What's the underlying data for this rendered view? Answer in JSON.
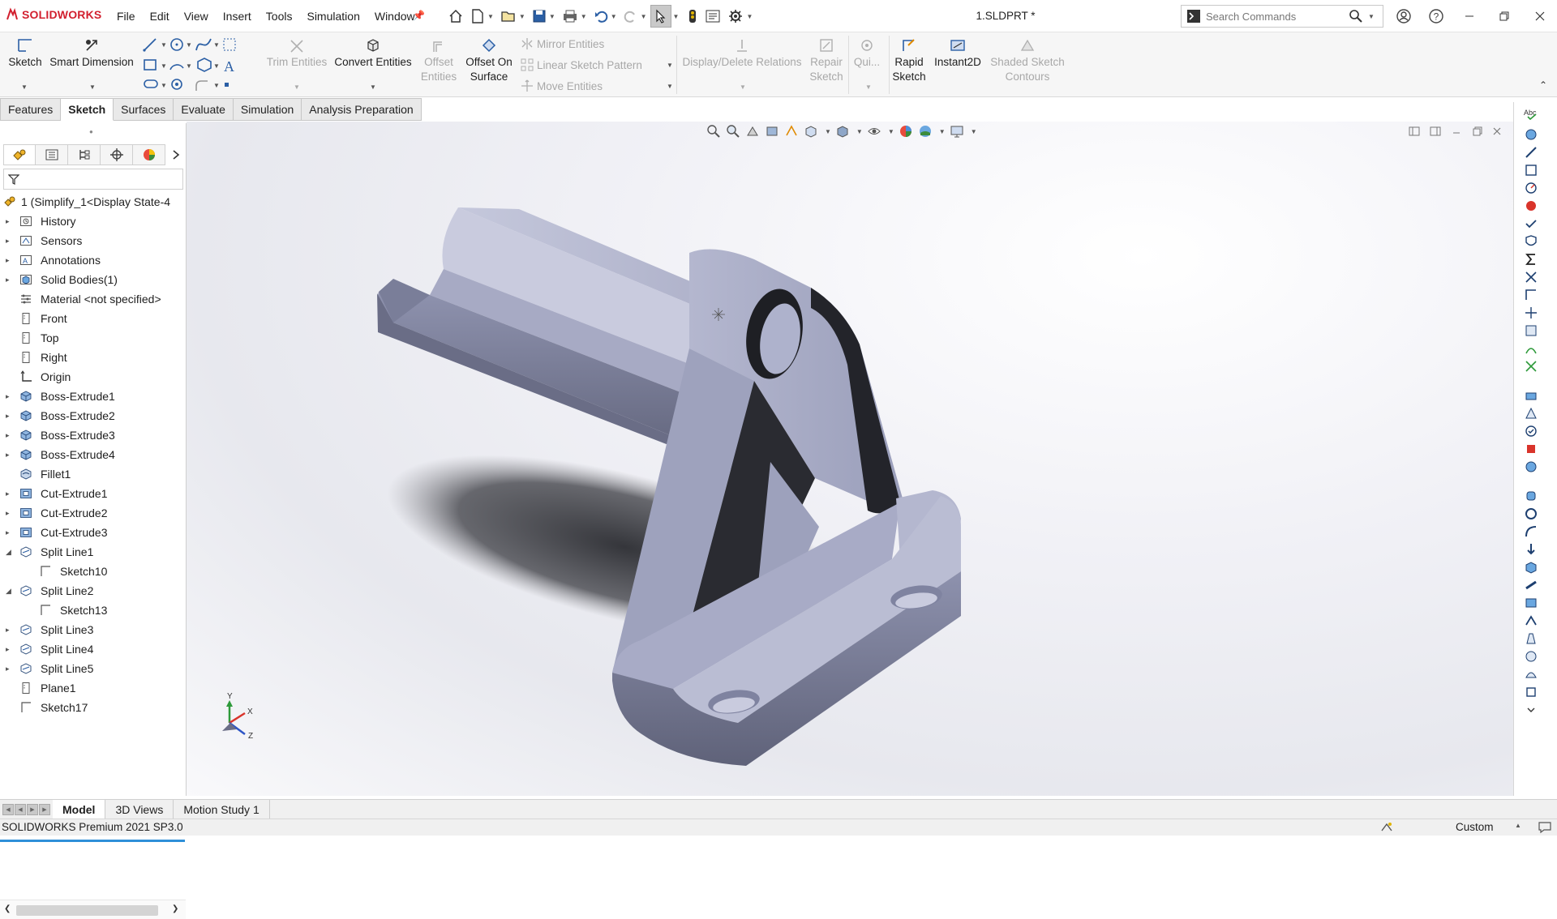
{
  "app": {
    "brand": "SOLIDWORKS",
    "brand_color": "#d2202f",
    "accent": "#2e8fd8",
    "model_color": "#a9adc8"
  },
  "menu": [
    "File",
    "Edit",
    "View",
    "Insert",
    "Tools",
    "Simulation",
    "Window"
  ],
  "window": {
    "title": "1.SLDPRT *"
  },
  "search": {
    "placeholder": "Search Commands"
  },
  "ribbon": {
    "sketch": "Sketch",
    "smart_dimension": "Smart Dimension",
    "trim_entities": "Trim Entities",
    "convert_entities": "Convert Entities",
    "offset_entities": [
      "Offset",
      "Entities"
    ],
    "offset_on_surface": [
      "Offset On",
      "Surface"
    ],
    "mirror_entities": "Mirror Entities",
    "linear_sketch_pattern": "Linear Sketch Pattern",
    "move_entities": "Move Entities",
    "display_delete_relations": "Display/Delete Relations",
    "repair_sketch": [
      "Repair",
      "Sketch"
    ],
    "quick_snaps": "Qui...",
    "rapid_sketch": [
      "Rapid",
      "Sketch"
    ],
    "instant2d": "Instant2D",
    "shaded_sketch_contours": [
      "Shaded Sketch",
      "Contours"
    ]
  },
  "command_tabs": [
    {
      "label": "Features",
      "active": false
    },
    {
      "label": "Sketch",
      "active": true
    },
    {
      "label": "Surfaces",
      "active": false
    },
    {
      "label": "Evaluate",
      "active": false
    },
    {
      "label": "Simulation",
      "active": false
    },
    {
      "label": "Analysis Preparation",
      "active": false
    }
  ],
  "tree": [
    {
      "label": "1  (Simplify_1<Display State-4",
      "icon": "part-icon",
      "expander": "none",
      "indent": 0
    },
    {
      "label": "History",
      "icon": "history-icon",
      "expander": "collapsed",
      "indent": 1
    },
    {
      "label": "Sensors",
      "icon": "sensors-icon",
      "expander": "collapsed",
      "indent": 1
    },
    {
      "label": "Annotations",
      "icon": "annotations-icon",
      "expander": "collapsed",
      "indent": 1
    },
    {
      "label": "Solid Bodies(1)",
      "icon": "solid-bodies-icon",
      "expander": "collapsed",
      "indent": 1
    },
    {
      "label": "Material <not specified>",
      "icon": "material-icon",
      "expander": "none",
      "indent": 1
    },
    {
      "label": "Front",
      "icon": "plane-icon",
      "expander": "none",
      "indent": 1
    },
    {
      "label": "Top",
      "icon": "plane-icon",
      "expander": "none",
      "indent": 1
    },
    {
      "label": "Right",
      "icon": "plane-icon",
      "expander": "none",
      "indent": 1
    },
    {
      "label": "Origin",
      "icon": "origin-icon",
      "expander": "none",
      "indent": 1
    },
    {
      "label": "Boss-Extrude1",
      "icon": "extrude-icon",
      "expander": "collapsed",
      "indent": 1
    },
    {
      "label": "Boss-Extrude2",
      "icon": "extrude-icon",
      "expander": "collapsed",
      "indent": 1
    },
    {
      "label": "Boss-Extrude3",
      "icon": "extrude-icon",
      "expander": "collapsed",
      "indent": 1
    },
    {
      "label": "Boss-Extrude4",
      "icon": "extrude-icon",
      "expander": "collapsed",
      "indent": 1
    },
    {
      "label": "Fillet1",
      "icon": "fillet-icon",
      "expander": "none",
      "indent": 1
    },
    {
      "label": "Cut-Extrude1",
      "icon": "cut-icon",
      "expander": "collapsed",
      "indent": 1
    },
    {
      "label": "Cut-Extrude2",
      "icon": "cut-icon",
      "expander": "collapsed",
      "indent": 1
    },
    {
      "label": "Cut-Extrude3",
      "icon": "cut-icon",
      "expander": "collapsed",
      "indent": 1
    },
    {
      "label": "Split Line1",
      "icon": "split-line-icon",
      "expander": "expanded",
      "indent": 1
    },
    {
      "label": "Sketch10",
      "icon": "sketch-icon",
      "expander": "none",
      "indent": 2
    },
    {
      "label": "Split Line2",
      "icon": "split-line-icon",
      "expander": "expanded",
      "indent": 1
    },
    {
      "label": "Sketch13",
      "icon": "sketch-icon",
      "expander": "none",
      "indent": 2
    },
    {
      "label": "Split Line3",
      "icon": "split-line-icon",
      "expander": "collapsed",
      "indent": 1
    },
    {
      "label": "Split Line4",
      "icon": "split-line-icon",
      "expander": "collapsed",
      "indent": 1
    },
    {
      "label": "Split Line5",
      "icon": "split-line-icon",
      "expander": "collapsed",
      "indent": 1
    },
    {
      "label": "Plane1",
      "icon": "plane-icon",
      "expander": "none",
      "indent": 1
    },
    {
      "label": "Sketch17",
      "icon": "sketch-icon",
      "expander": "none",
      "indent": 1
    }
  ],
  "triad": {
    "x": "X",
    "y": "Y",
    "z": "Z"
  },
  "bottom_tabs": [
    {
      "label": "Model",
      "active": true
    },
    {
      "label": "3D Views",
      "active": false
    },
    {
      "label": "Motion Study 1",
      "active": false
    }
  ],
  "status": {
    "version": "SOLIDWORKS Premium 2021 SP3.0",
    "units": "Custom"
  }
}
